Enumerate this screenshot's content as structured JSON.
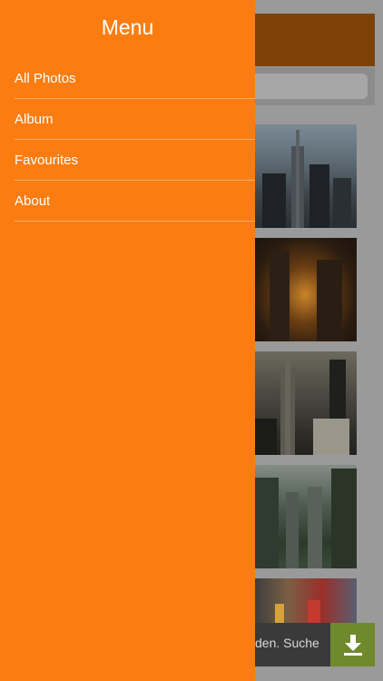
{
  "drawer": {
    "title": "Menu",
    "items": [
      {
        "label": "All Photos"
      },
      {
        "label": "Album"
      },
      {
        "label": "Favourites"
      },
      {
        "label": "About"
      }
    ]
  },
  "background": {
    "photos": [
      "city-photo-1",
      "city-photo-2",
      "city-photo-3",
      "city-photo-4",
      "city-photo-5"
    ]
  },
  "ad_banner": {
    "text": "den. Suche",
    "icon": "download-icon"
  },
  "colors": {
    "drawer": "#fb7d12",
    "header_dimmed": "#7e4108",
    "ad_button": "#6f8a2c"
  }
}
